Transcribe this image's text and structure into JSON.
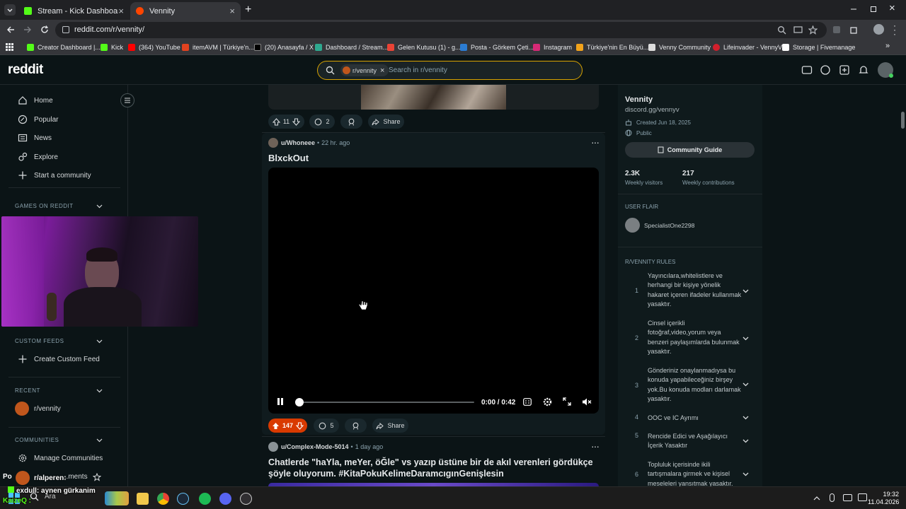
{
  "browser": {
    "tabs": [
      {
        "label": "Stream - Kick Dashboard",
        "active": false
      },
      {
        "label": "Vennity",
        "active": true
      }
    ],
    "url": "reddit.com/r/vennity/",
    "bookmarks": [
      "Creator Dashboard |...",
      "Kick",
      "(364) YouTube",
      "itemAVM | Türkiye'n...",
      "(20) Anasayfa / X",
      "Dashboard / Stream...",
      "Gelen Kutusu (1) - g...",
      "Posta - Görkem Çeti...",
      "Instagram",
      "Türkiye'nin En Büyü...",
      "Venny Community",
      "Lifeinvader - VennyV",
      "Storage | Fivemanage"
    ]
  },
  "header": {
    "logo": "reddit",
    "search_chip": "r/vennity",
    "search_placeholder": "Search in r/vennity"
  },
  "left_nav": {
    "items": [
      "Home",
      "Popular",
      "News",
      "Explore",
      "Start a community"
    ],
    "games_title": "GAMES ON REDDIT",
    "custom_feeds_title": "CUSTOM FEEDS",
    "create_custom_feed": "Create Custom Feed",
    "recent_title": "RECENT",
    "recent_item": "r/vennity",
    "communities_title": "COMMUNITIES",
    "manage_communities": "Manage Communities",
    "partial_item": "...ments"
  },
  "stream_overlay": {
    "chat_line_1": "r/alperen:",
    "chat_user": "exdull",
    "chat_msg": ": aynen gürkanim",
    "chat_tag": "KaizeQ :",
    "prefix": "Po"
  },
  "feed": {
    "prev_post": {
      "upvotes": "11",
      "comments": "2",
      "share": "Share"
    },
    "post": {
      "author": "u/Whoneee",
      "time": "22 hr. ago",
      "title": "BlxckOut",
      "video_time": "0:00 / 0:42",
      "video_progress": 0.0,
      "upvotes": "147",
      "comments": "5",
      "share": "Share"
    },
    "next_post": {
      "author": "u/Complex-Mode-5014",
      "time": "1 day ago",
      "title": "Chatlerde \"haYla, meYer, öĞle\" vs yazıp üstüne bir de akıl verenleri gördükçe şöyle oluyorum. #KitaPokuKelimeDaramcıgınGenişlesin"
    }
  },
  "community": {
    "name": "Vennity",
    "link": "discord.gg/vennyv",
    "created": "Created Jun 18, 2025",
    "visibility": "Public",
    "guide_button": "Community Guide",
    "stats": [
      {
        "value": "2.3K",
        "label": "Weekly visitors"
      },
      {
        "value": "217",
        "label": "Weekly contributions"
      }
    ],
    "flair_title": "USER FLAIR",
    "flair_user": "SpecialistOne2298",
    "rules_title": "R/VENNITY RULES",
    "rules": [
      {
        "n": "1",
        "text": "Yayıncılara,whitelistlere ve herhangi bir kişiye yönelik hakaret içeren ifadeler kullanmak yasaktır."
      },
      {
        "n": "2",
        "text": "Cinsel içerikli fotoğraf,video,yorum veya benzeri paylaşımlarda bulunmak yasaktır."
      },
      {
        "n": "3",
        "text": "Gönderiniz onaylanmadıysa bu konuda yapabileceğiniz birşey yok.Bu konuda modları darlamak yasaktır."
      },
      {
        "n": "4",
        "text": "OOC ve IC Ayrımı"
      },
      {
        "n": "5",
        "text": "Rencide Edici ve Aşağılayıcı İçerik Yasaktır"
      },
      {
        "n": "6",
        "text": "Topluluk içerisinde ikili tartışmalara girmek ve kişisel meseleleri yansıtmak yasaktır."
      }
    ]
  },
  "taskbar": {
    "search_label": "Ara",
    "time": "19:32",
    "date": "11.04.2026"
  },
  "colors": {
    "accent": "#ff4500",
    "bg": "#0b1416",
    "search_border": "#d8a300"
  }
}
